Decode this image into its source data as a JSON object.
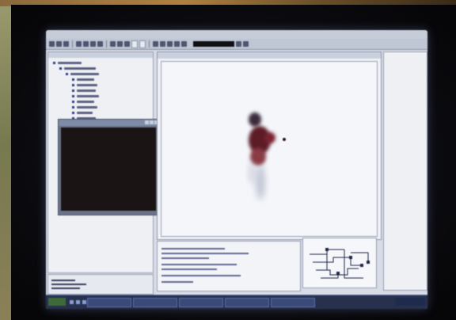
{
  "scene": {
    "wall_color": "#8a8a60",
    "bezel_color": "#0b0b10",
    "screen_color": "#d8dce6"
  },
  "app": {
    "menu_items": [
      "",
      "",
      "",
      "",
      ""
    ],
    "toolbar_tabs": [
      "",
      ""
    ]
  },
  "icons": {
    "tree_node": "square-bullet-icon",
    "window_controls": [
      "minimize-icon",
      "maximize-icon",
      "close-icon"
    ],
    "start": "start-icon",
    "task": "app-icon"
  },
  "panels": {
    "tree_title": "",
    "console_title": "",
    "viewport_title": "",
    "start_label": "",
    "tray_text": ""
  },
  "colors": {
    "accent": "#2b3a8a",
    "taskbar": "#27314e",
    "figure": "#6a1f2a"
  }
}
